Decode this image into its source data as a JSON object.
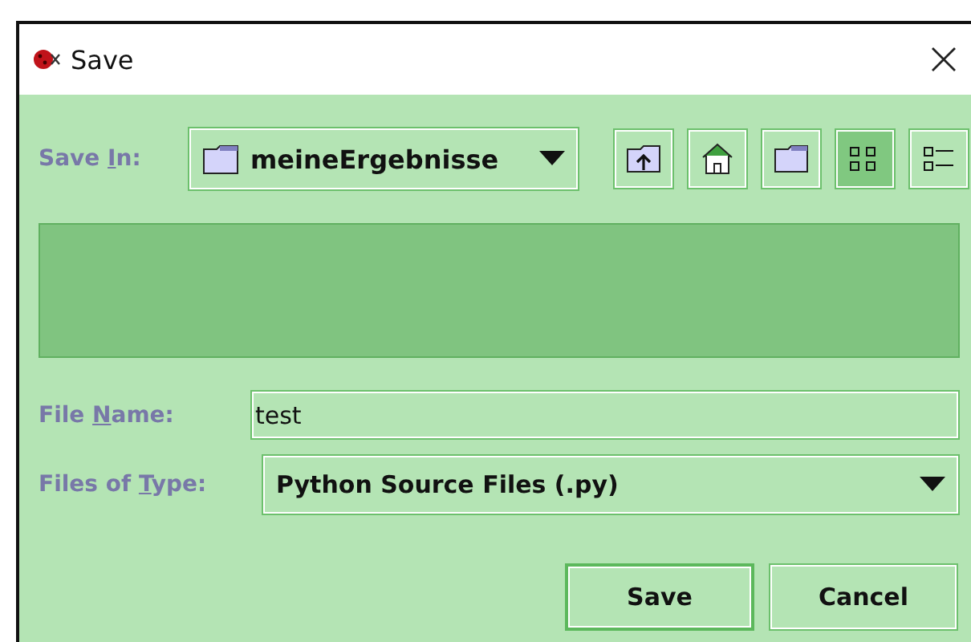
{
  "window": {
    "title": "Save"
  },
  "save_in": {
    "label": {
      "before": "Save ",
      "key": "I",
      "after": "n:"
    },
    "value": "meineErgebnisse"
  },
  "toolbar": [
    {
      "kind": "up",
      "selected": false
    },
    {
      "kind": "home",
      "selected": false
    },
    {
      "kind": "newfolder",
      "selected": false
    },
    {
      "kind": "list",
      "selected": true
    },
    {
      "kind": "details",
      "selected": false
    }
  ],
  "file_name": {
    "label": {
      "before": "File ",
      "key": "N",
      "after": "ame:"
    },
    "value": "test"
  },
  "file_type": {
    "label": {
      "before": "Files of ",
      "key": "T",
      "after": "ype:"
    },
    "value": "Python Source Files (.py)"
  },
  "buttons": [
    {
      "label": "Save",
      "selected": true
    },
    {
      "label": "Cancel",
      "selected": false
    }
  ]
}
